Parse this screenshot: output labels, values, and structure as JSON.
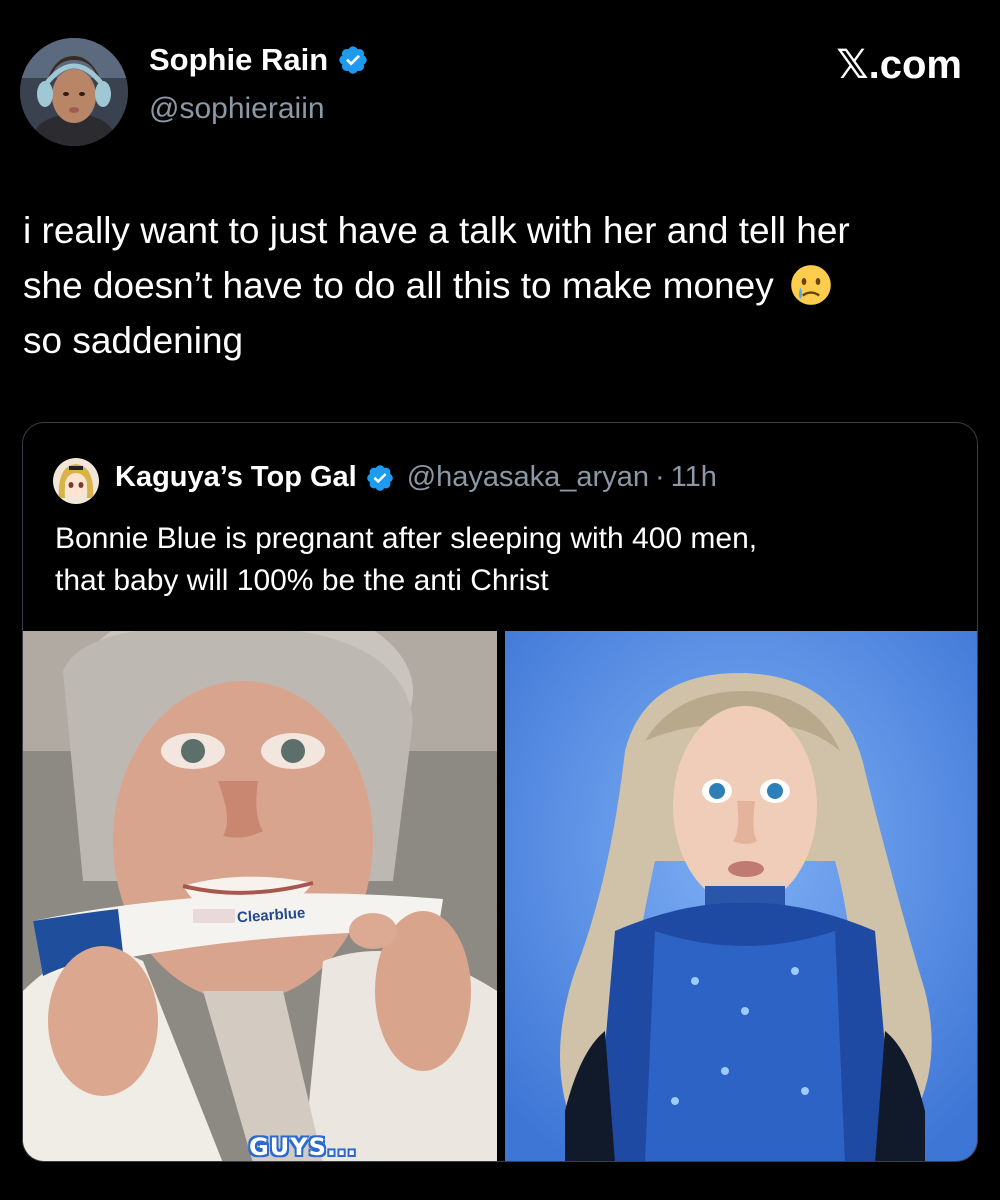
{
  "author": {
    "name": "Sophie Rain",
    "handle": "@sophieraiin",
    "verified": true
  },
  "brand": {
    "logo_icon": "x-logo-icon",
    "text": "𝕏.com"
  },
  "tweet": {
    "lines": [
      "i really want to just have a talk with her and tell her",
      "she doesn’t have to do all this to make money",
      "so saddening"
    ],
    "emoji": "crying-face-emoji"
  },
  "quote": {
    "name": "Kaguya’s Top Gal",
    "handle": "@hayasaka_aryan",
    "separator": "·",
    "time": "11h",
    "verified": true,
    "lines": [
      "Bonnie Blue is pregnant after sleeping with 400 men,",
      "that baby will 100% be the anti Christ"
    ],
    "media": [
      {
        "description_icon": "photo-pregnancy-test",
        "caption": "GUYS...",
        "test_brand": "Clearblue"
      },
      {
        "description_icon": "photo-portrait-blue-background"
      }
    ]
  },
  "colors": {
    "background": "#000000",
    "text": "#ffffff",
    "secondary_text": "#8b98a5",
    "verified_blue": "#1d9bf0",
    "border": "#3a3f45"
  }
}
